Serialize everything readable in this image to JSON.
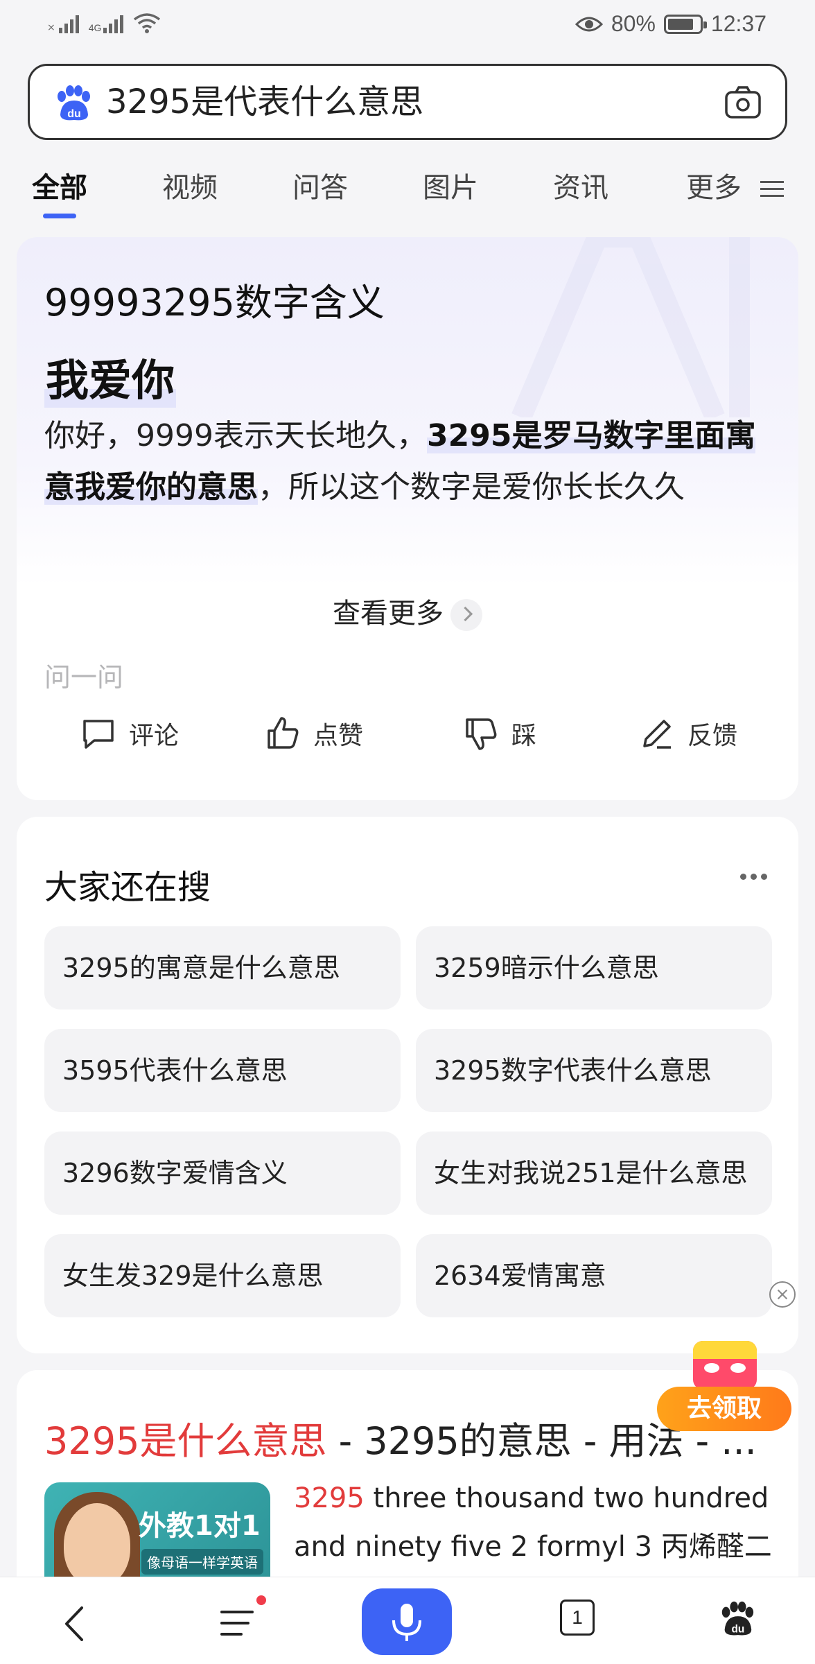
{
  "status_bar": {
    "network": "4G",
    "battery": "80%",
    "time": "12:37"
  },
  "search": {
    "query": "3295是代表什么意思"
  },
  "tabs": [
    "全部",
    "视频",
    "问答",
    "图片",
    "资讯",
    "更多"
  ],
  "ai_card": {
    "title": "99993295数字含义",
    "answer": "我爱你",
    "body_intro": "你好，9999表示天长地久，",
    "body_bold": "3295是罗马数字里面寓意我爱你的意思",
    "body_rest": "，所以这个数字是爱你长长久久",
    "see_more": "查看更多",
    "ask_placeholder": "问一问",
    "actions": [
      "评论",
      "点赞",
      "踩",
      "反馈"
    ]
  },
  "related": {
    "title": "大家还在搜",
    "items": [
      "3295的寓意是什么意思",
      "3259暗示什么意思",
      "3595代表什么意思",
      "3295数字代表什么意思",
      "3296数字爱情含义",
      "女生对我说251是什么意思",
      "女生发329是什么意思",
      "2634爱情寓意"
    ]
  },
  "result": {
    "title_highlight": "3295是什么意思",
    "title_rest": " - 3295的意思 - 用法 - ...",
    "thumb_banner": "外教1对1",
    "thumb_sub": "像母语一样学英语",
    "snippet_highlight": "3295",
    "snippet_rest": " three thousand two hundred and ninety five 2 formyl 3 丙烯醛二"
  },
  "reward": {
    "label": "去领取"
  },
  "bottom_nav": {
    "tab_count": "1"
  },
  "colors": {
    "accent": "#3d63f5",
    "highlight_red": "#e23b3b",
    "reward_orange": "#ff8a1a"
  }
}
